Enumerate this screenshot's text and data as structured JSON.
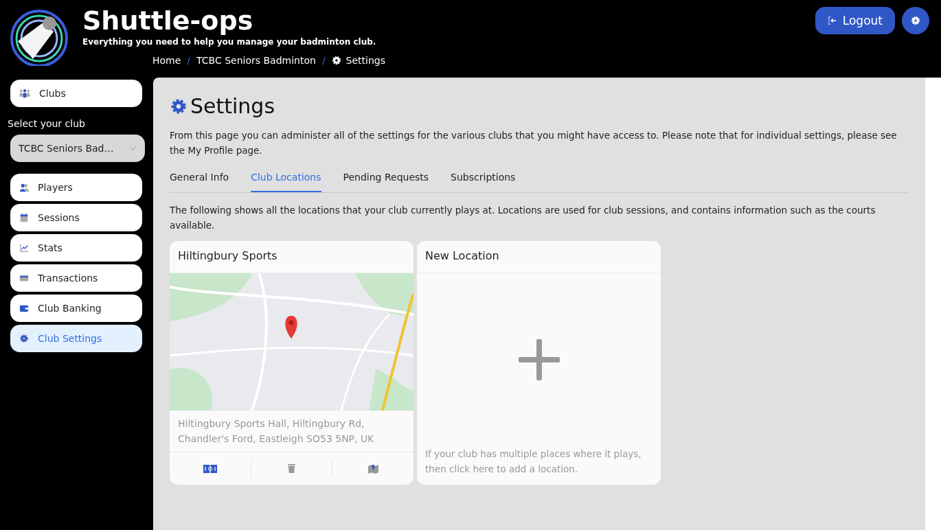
{
  "app": {
    "title": "Shuttle-ops",
    "tagline": "Everything you need to help you manage your badminton club."
  },
  "header": {
    "logout": "Logout"
  },
  "breadcrumb_separator": "/",
  "breadcrumb": [
    {
      "label": "Home"
    },
    {
      "label": "TCBC Seniors Badminton"
    },
    {
      "label": "Settings"
    }
  ],
  "sidebar": {
    "clubs": "Clubs",
    "select_label": "Select your club",
    "select_value": "TCBC Seniors Bad…",
    "items": [
      {
        "label": "Players",
        "selected": false
      },
      {
        "label": "Sessions",
        "selected": false
      },
      {
        "label": "Stats",
        "selected": false
      },
      {
        "label": "Transactions",
        "selected": false
      },
      {
        "label": "Club Banking",
        "selected": false
      },
      {
        "label": "Club Settings",
        "selected": true
      }
    ]
  },
  "page": {
    "title": "Settings",
    "intro": "From this page you can administer all of the settings for the various clubs that you might have access to. Please note that for individual settings, please see the My Profile page.",
    "tabs": [
      {
        "label": "General Info",
        "selected": false
      },
      {
        "label": "Club Locations",
        "selected": true
      },
      {
        "label": "Pending Requests",
        "selected": false
      },
      {
        "label": "Subscriptions",
        "selected": false
      }
    ],
    "description": "The following shows all the locations that your club currently plays at. Locations are used for club sessions, and contains information such as the courts available.",
    "cards": [
      {
        "kind": "location",
        "title": "Hiltingbury Sports",
        "address": "Hiltingbury Sports Hall, Hiltingbury Rd, Chandler's Ford, Eastleigh SO53 5NP, UK"
      },
      {
        "kind": "new",
        "title": "New Location",
        "hint": "If your club has multiple places where it plays, then click here to add a location."
      }
    ]
  }
}
